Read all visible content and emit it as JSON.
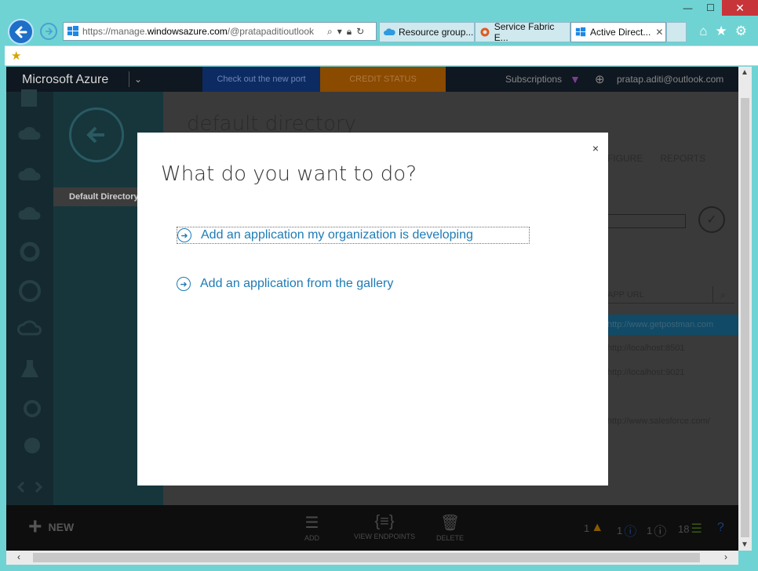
{
  "browser": {
    "address_host": "https://manage.",
    "address_domain": "windowsazure.com",
    "address_rest": "/@pratapaditioutlook",
    "tabs": [
      {
        "label": "Resource group...",
        "active": false
      },
      {
        "label": "Service Fabric E...",
        "active": false
      },
      {
        "label": "Active Direct...",
        "active": true
      }
    ]
  },
  "azure": {
    "brand": "Microsoft Azure",
    "promo": "Check out the new port",
    "credit": "CREDIT STATUS",
    "subscriptions": "Subscriptions",
    "user": "pratap.aditi@outlook.com"
  },
  "directory": {
    "item": "Default Directory"
  },
  "main": {
    "title": "default directory",
    "tabs": [
      "FIGURE",
      "REPORTS"
    ],
    "column_header": "APP URL",
    "urls": [
      "http://www.getpostman.com",
      "http://localhost:8501",
      "http://localhost:9021",
      "http://www.salesforce.com/"
    ]
  },
  "commands": {
    "new": "NEW",
    "add": "ADD",
    "view_endpoints": "VIEW ENDPOINTS",
    "delete": "DELETE"
  },
  "status": {
    "warnings": "1",
    "info": "1",
    "info2": "1",
    "tasks": "18"
  },
  "dialog": {
    "title": "What do you want to do?",
    "close": "×",
    "option1": "Add an application my organization is developing",
    "option2": "Add an application from the gallery"
  }
}
